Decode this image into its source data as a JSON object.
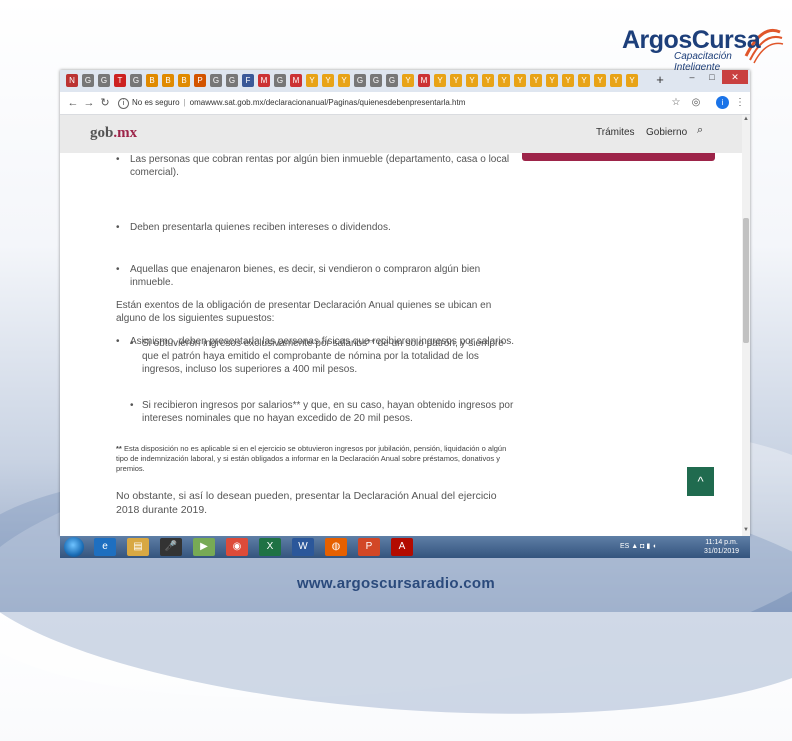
{
  "brand": {
    "logo_main_1": "Argos",
    "logo_main_2": "Cursa",
    "logo_sub_1": "Capacitación",
    "logo_sub_2": "Inteligente",
    "website": "www.argoscursaradio.com",
    "colors": {
      "primary": "#1d3f7a",
      "accent": "#e0562a"
    }
  },
  "browser": {
    "tabs_icons": [
      "N",
      "G",
      "G",
      "T",
      "G",
      "B",
      "B",
      "B",
      "P",
      "G",
      "G",
      "F",
      "M",
      "G",
      "M",
      "Y",
      "Y",
      "Y",
      "G",
      "G",
      "G",
      "Y",
      "M",
      "Y",
      "Y",
      "Y",
      "Y",
      "Y",
      "Y",
      "Y",
      "Y",
      "Y",
      "Y",
      "Y",
      "Y",
      "Y"
    ],
    "window_controls": {
      "minimize": "–",
      "maximize": "□",
      "close": "✕"
    },
    "new_tab": "+",
    "omnibox": {
      "security": "No es seguro",
      "url": "omawww.sat.gob.mx/declaracionanual/Paginas/quienesdebenpresentarla.htm"
    }
  },
  "site": {
    "logo_gob": "gob",
    "logo_mx": ".mx",
    "nav": [
      "Trámites",
      "Gobierno"
    ],
    "colors": {
      "brand": "#9d2449",
      "header_bg": "#eaeaea"
    }
  },
  "content": {
    "items": [
      "Las personas que cobran rentas por algún bien inmueble (departamento, casa o local comercial).",
      "Deben presentarla quienes reciben intereses o dividendos.",
      "Aquellas que enajenaron bienes, es decir, si vendieron o compraron algún bien inmueble.",
      "Asimismo, deben presentarla las personas físicas que recibieron ingresos por salarios."
    ],
    "exempt_intro": "Están exentos de la obligación de presentar Declaración Anual quienes se ubican en alguno de los siguientes supuestos:",
    "exempt_items": [
      "Si obtuvieron ingresos exclusivamente por salarios** de un solo patrón, y siempre que el patrón haya emitido el comprobante de nómina por la totalidad de los ingresos, incluso los superiores a 400 mil pesos.",
      "Si recibieron ingresos por salarios** y que, en su caso, hayan obtenido ingresos por intereses nominales que no hayan excedido de 20 mil pesos."
    ],
    "note_mark": "**",
    "note": "Esta disposición no es aplicable si en el ejercicio se obtuvieron ingresos por jubilación, pensión, liquidación o algún tipo de indemnización laboral, y si están obligados a informar en la Declaración Anual sobre préstamos, donativos y premios.",
    "closing": "No obstante, si así lo desean pueden, presentar la Declaración Anual del ejercicio 2018 durante 2019.",
    "back_to_top": "^"
  },
  "taskbar": {
    "apps": [
      "IE",
      "Explorer",
      "Mic",
      "Media",
      "Chrome",
      "Excel",
      "Word",
      "Firefox",
      "PowerPoint",
      "Acrobat"
    ],
    "tray": "ES",
    "time": "11:14 p.m.",
    "date": "31/01/2019"
  }
}
